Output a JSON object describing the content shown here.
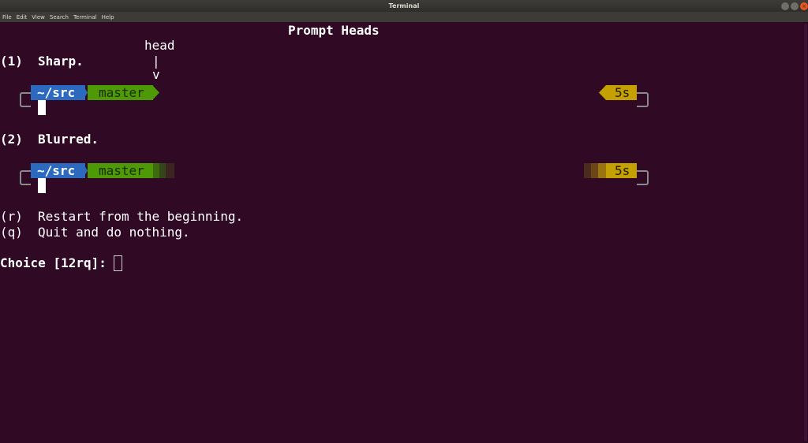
{
  "window": {
    "title": "Terminal",
    "buttons": [
      "minimize",
      "maximize",
      "close"
    ],
    "close_symbol": "×",
    "accent": "#e95420"
  },
  "menu": [
    "File",
    "Edit",
    "View",
    "Search",
    "Terminal",
    "Help"
  ],
  "terminal": {
    "background": "#300a24",
    "heading": "Prompt Heads",
    "annotation": {
      "label": "head",
      "line": "|",
      "arrow": "v"
    },
    "option1": {
      "key": "(1)",
      "label": "Sharp."
    },
    "option2": {
      "key": "(2)",
      "label": "Blurred."
    },
    "prompt": {
      "path": "~/src",
      "branch": "master",
      "duration": "5s"
    },
    "option_r": {
      "key": "(r)",
      "label": "Restart from the beginning."
    },
    "option_q": {
      "key": "(q)",
      "label": "Quit and do nothing."
    },
    "choice_prompt": "Choice [12rq]:"
  },
  "colors": {
    "path_bg": "#2c6abf",
    "branch_bg": "#4e9a06",
    "duration_bg": "#c4a000"
  }
}
